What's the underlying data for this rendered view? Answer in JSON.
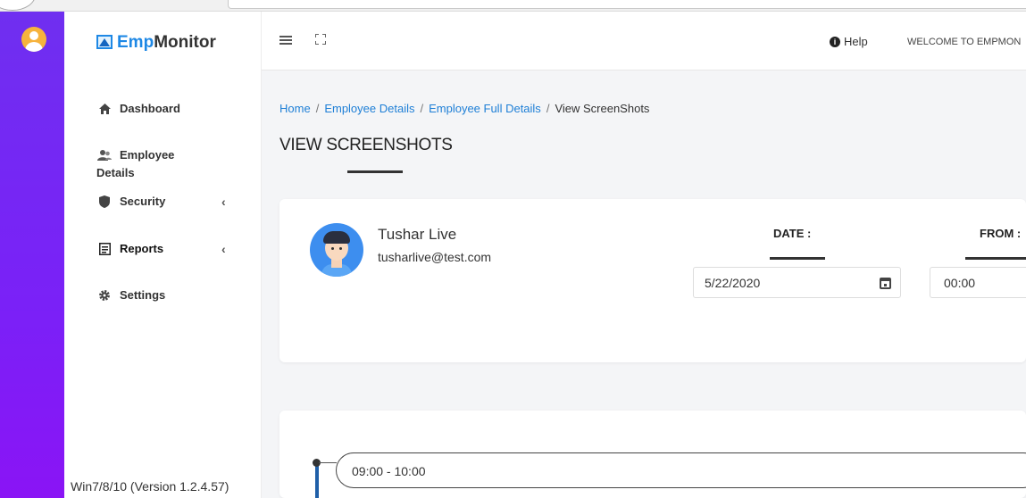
{
  "brand": {
    "logo_prefix": "Emp",
    "logo_suffix": "Monitor"
  },
  "sidebar": {
    "items": [
      {
        "label": "Dashboard",
        "icon": "home-icon"
      },
      {
        "label_line1": "Employee",
        "label_line2": "Details",
        "icon": "user-group-icon"
      },
      {
        "label": "Security",
        "icon": "shield-icon",
        "chevron": "‹"
      },
      {
        "label": "Reports",
        "icon": "report-icon",
        "chevron": "‹"
      },
      {
        "label": "Settings",
        "icon": "gear-icon"
      }
    ],
    "version": "Win7/8/10 (Version 1.2.4.57)"
  },
  "header": {
    "help_label": "Help",
    "welcome_text": "WELCOME TO EMPMON"
  },
  "breadcrumb": {
    "home": "Home",
    "sep": "/",
    "employee_details": "Employee Details",
    "employee_full_details": "Employee Full Details",
    "current": "View ScreenShots"
  },
  "page_title": "VIEW SCREENSHOTS",
  "employee": {
    "name": "Tushar Live",
    "email": "tusharlive@test.com"
  },
  "filters": {
    "date_label": "DATE :",
    "date_value": "5/22/2020",
    "from_label": "FROM :",
    "from_value": "00:00"
  },
  "timeline": {
    "slot_label": "09:00 - 10:00"
  },
  "colors": {
    "rail": "#7a21f7",
    "accent": "#1e88e5",
    "link": "#1e7fd6"
  }
}
